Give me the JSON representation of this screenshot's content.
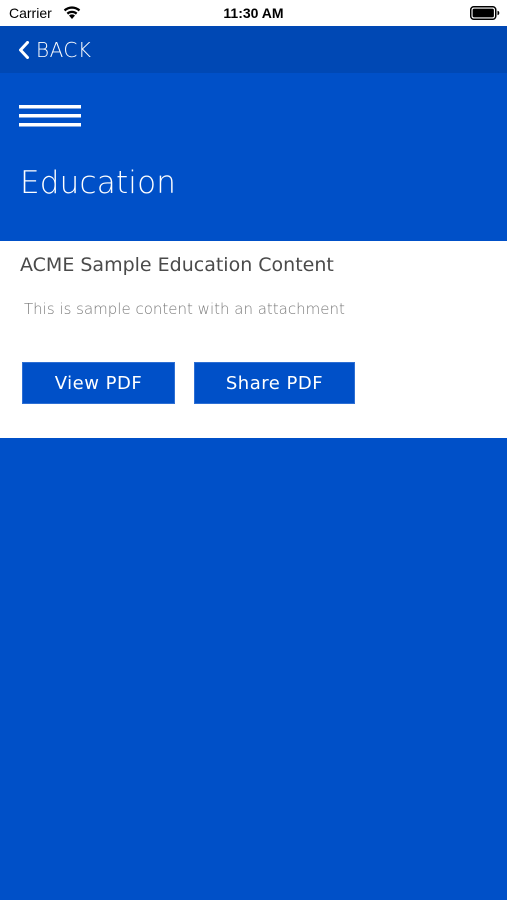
{
  "status_bar": {
    "carrier": "Carrier",
    "time": "11:30 AM",
    "wifi_icon": "wifi-icon",
    "battery_icon": "battery-icon"
  },
  "nav": {
    "back_label": "BACK",
    "back_icon": "chevron-left-icon"
  },
  "header": {
    "menu_icon": "hamburger-menu-icon",
    "title": "Education"
  },
  "content": {
    "title": "ACME Sample Education Content",
    "description": "This is sample content with an attachment",
    "buttons": [
      {
        "label": "View PDF"
      },
      {
        "label": "Share PDF"
      }
    ]
  },
  "colors": {
    "primary_blue": "#0050c8",
    "nav_blue": "#0048b4",
    "card_background": "#ffffff",
    "title_text": "#4a4a4a",
    "description_text": "#7a7a7a"
  }
}
